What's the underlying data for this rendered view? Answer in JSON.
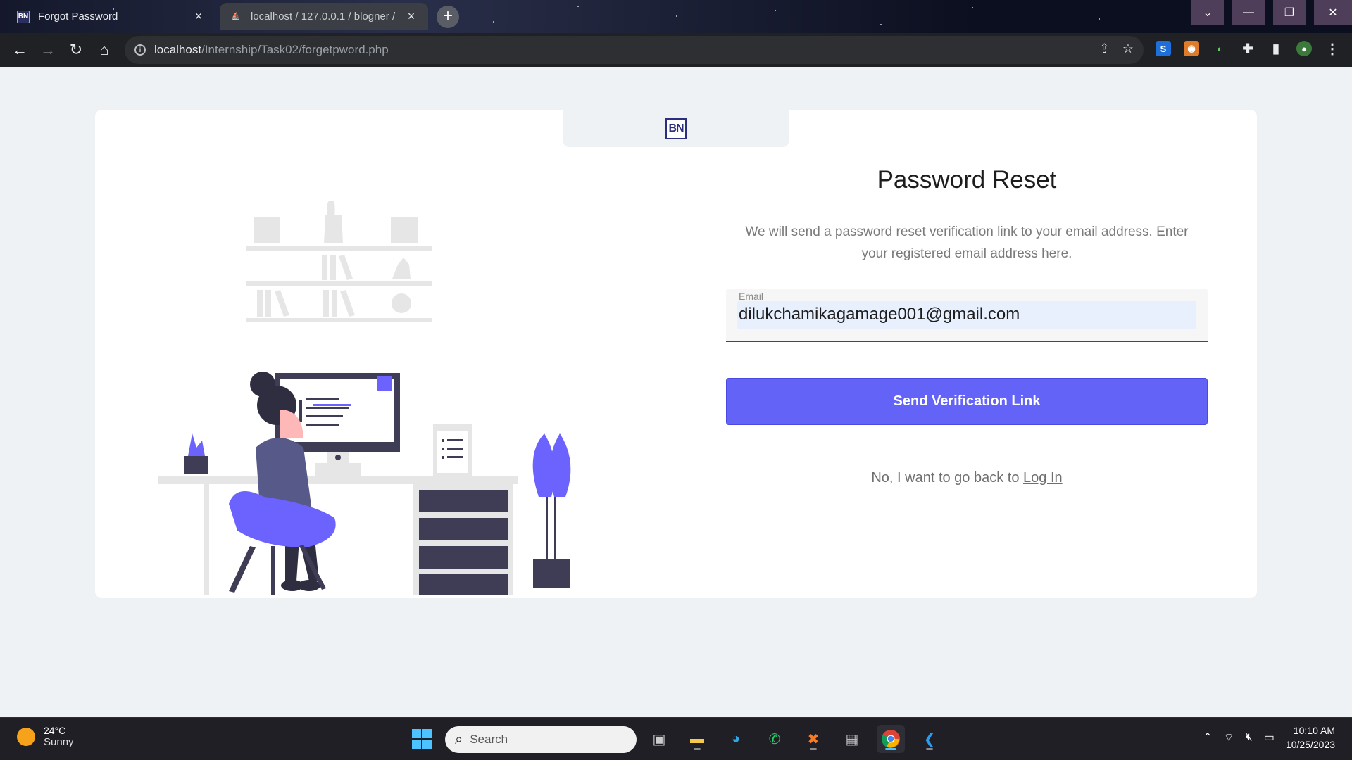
{
  "browser": {
    "tabs": [
      {
        "title": "Forgot Password",
        "favicon": "BN",
        "active": true
      },
      {
        "title": "localhost / 127.0.0.1 / blogner /",
        "favicon": "pma",
        "active": false
      }
    ],
    "new_tab_label": "+",
    "url_host": "localhost",
    "url_path": "/Internship/Task02/forgetpword.php"
  },
  "page": {
    "logo_text": "BN",
    "title": "Password Reset",
    "description": "We will send a password reset verification link to your email address. Enter your registered email address here.",
    "email_label": "Email",
    "email_value": "dilukchamikagamage001@gmail.com",
    "submit_label": "Send Verification Link",
    "back_text": "No, I want to go back to ",
    "back_link": "Log In"
  },
  "taskbar": {
    "weather_temp": "24°C",
    "weather_cond": "Sunny",
    "search_placeholder": "Search",
    "time": "10:10 AM",
    "date": "10/25/2023"
  },
  "colors": {
    "accent": "#6363f7",
    "page_bg": "#eef2f5",
    "dark_illustration": "#3f3d56"
  }
}
